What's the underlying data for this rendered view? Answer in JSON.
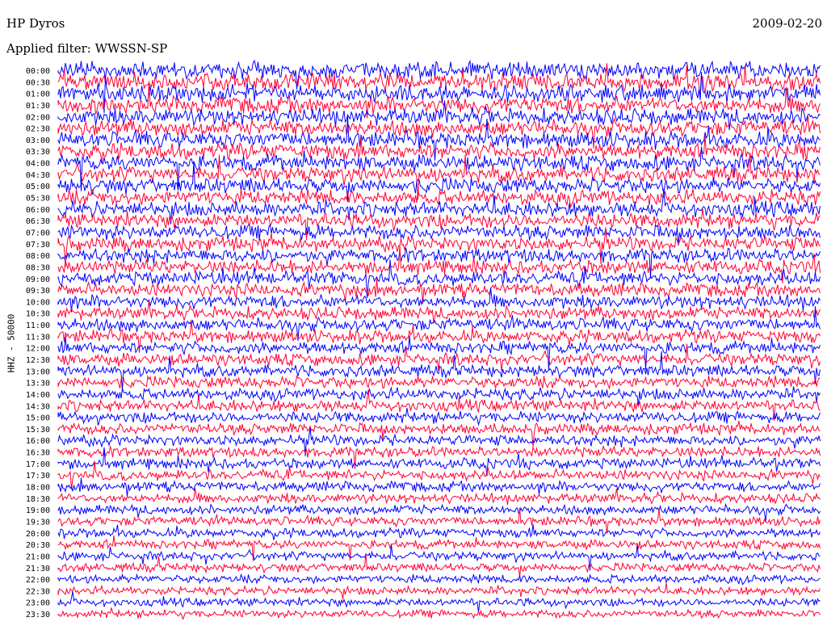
{
  "header": {
    "station": "HP Dyros",
    "date": "2009-02-20",
    "filter": "Applied filter: WWSSN-SP"
  },
  "channel_label": "HHZ - 50000",
  "colors": {
    "trace_a": "#0000ff",
    "trace_b": "#ff0033",
    "background": "#ffffff"
  },
  "chart_data": {
    "type": "line",
    "title": "HP Dyros",
    "rows": [
      "00:00",
      "00:30",
      "01:00",
      "01:30",
      "02:00",
      "02:30",
      "03:00",
      "03:30",
      "04:00",
      "04:30",
      "05:00",
      "05:30",
      "06:00",
      "06:30",
      "07:00",
      "07:30",
      "08:00",
      "08:30",
      "09:00",
      "09:30",
      "10:00",
      "10:30",
      "11:00",
      "11:30",
      "12:00",
      "12:30",
      "13:00",
      "13:30",
      "14:00",
      "14:30",
      "15:00",
      "15:30",
      "16:00",
      "16:30",
      "17:00",
      "17:30",
      "18:00",
      "18:30",
      "19:00",
      "19:30",
      "20:00",
      "20:30",
      "21:00",
      "21:30",
      "22:00",
      "22:30",
      "23:00",
      "23:30"
    ],
    "row_colors": [
      "trace_a",
      "trace_b"
    ],
    "ylabel": "HHZ - 50000",
    "legend": "none",
    "grid": false
  }
}
